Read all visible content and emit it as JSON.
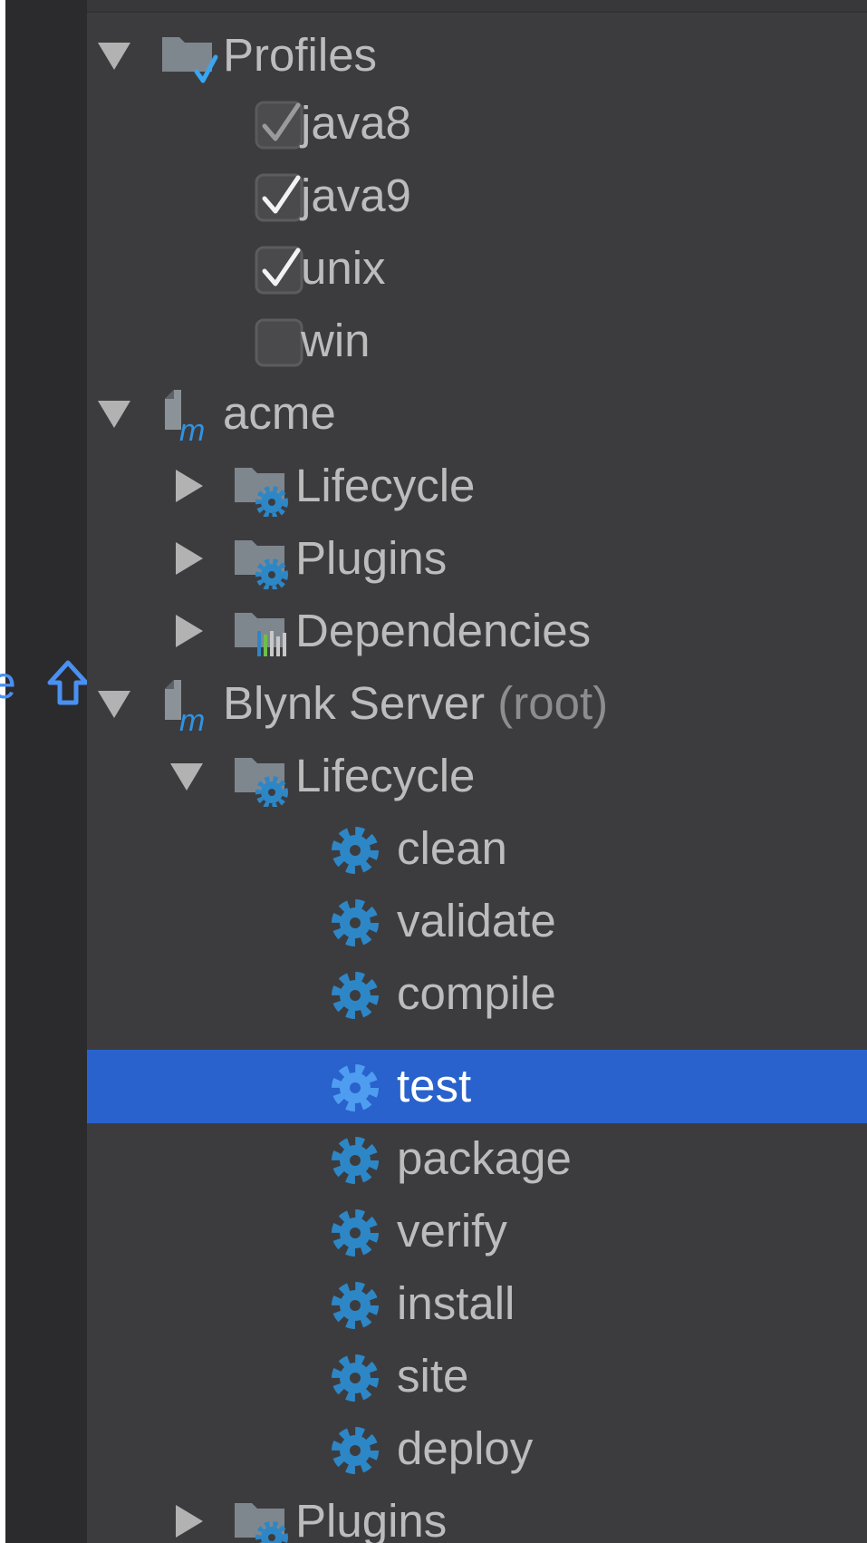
{
  "tree": {
    "profiles": {
      "label": "Profiles",
      "items": [
        {
          "label": "java8",
          "checked": true,
          "disabled": true
        },
        {
          "label": "java9",
          "checked": true,
          "disabled": false
        },
        {
          "label": "unix",
          "checked": true,
          "disabled": false
        },
        {
          "label": "win",
          "checked": false,
          "disabled": false
        }
      ]
    },
    "acme": {
      "label": "acme",
      "children": [
        "Lifecycle",
        "Plugins",
        "Dependencies"
      ]
    },
    "blynk": {
      "label": "Blynk Server",
      "suffix": "(root)",
      "lifecycle": {
        "label": "Lifecycle",
        "goals": [
          "clean",
          "validate",
          "compile",
          "test",
          "package",
          "verify",
          "install",
          "site",
          "deploy"
        ],
        "selected": "test"
      },
      "plugins": {
        "label": "Plugins"
      }
    }
  },
  "gutter": {
    "text": "e"
  },
  "colors": {
    "panel": "#3c3c3f",
    "gutter": "#2b2b2d",
    "selection": "#2962cc",
    "text": "#bcbcbc",
    "gear": "#2d87c7",
    "accent": "#4a90f2"
  }
}
